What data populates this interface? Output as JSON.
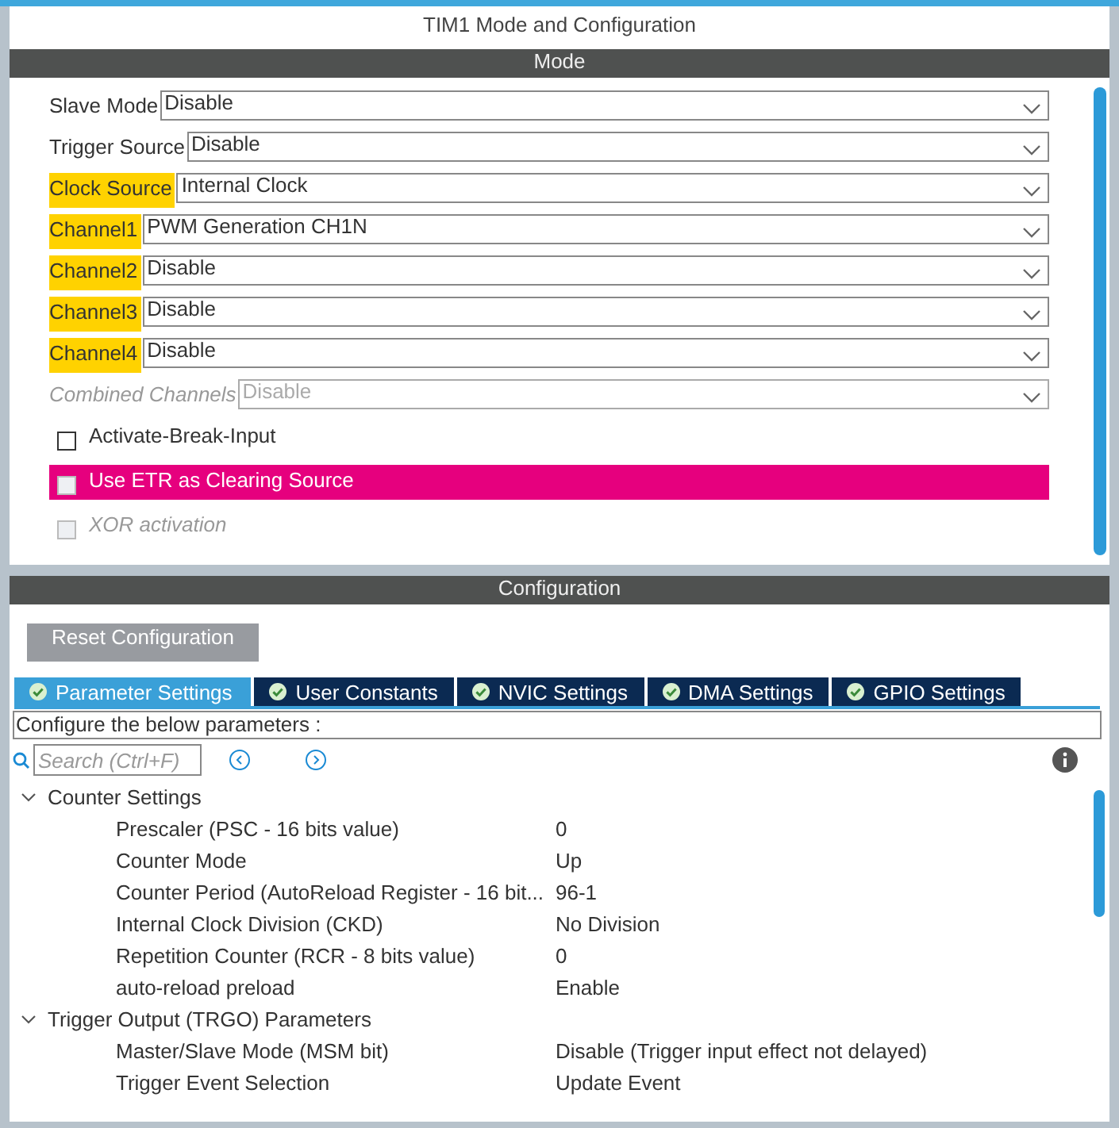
{
  "window": {
    "title": "TIM1 Mode and Configuration"
  },
  "mode": {
    "header": "Mode",
    "items": [
      {
        "kind": "select",
        "label": "Slave Mode",
        "value": "Disable",
        "highlighted": false,
        "disabled": false
      },
      {
        "kind": "select",
        "label": "Trigger Source",
        "value": "Disable",
        "highlighted": false,
        "disabled": false
      },
      {
        "kind": "select",
        "label": "Clock Source",
        "value": "Internal Clock",
        "highlighted": true,
        "disabled": false
      },
      {
        "kind": "select",
        "label": "Channel1",
        "value": "PWM Generation CH1N",
        "highlighted": true,
        "disabled": false
      },
      {
        "kind": "select",
        "label": "Channel2",
        "value": "Disable",
        "highlighted": true,
        "disabled": false
      },
      {
        "kind": "select",
        "label": "Channel3",
        "value": "Disable",
        "highlighted": true,
        "disabled": false
      },
      {
        "kind": "select",
        "label": "Channel4",
        "value": "Disable",
        "highlighted": true,
        "disabled": false
      },
      {
        "kind": "select",
        "label": "Combined Channels",
        "value": "Disable",
        "highlighted": false,
        "disabled": true
      },
      {
        "kind": "checkbox",
        "label": "Activate-Break-Input",
        "checked": false,
        "highlighted": false,
        "disabled": false
      },
      {
        "kind": "checkbox",
        "label": "Use ETR as Clearing Source",
        "checked": false,
        "highlighted": true,
        "disabled": true
      },
      {
        "kind": "checkbox",
        "label": "XOR activation",
        "checked": false,
        "highlighted": false,
        "disabled": true
      }
    ]
  },
  "configuration": {
    "header": "Configuration",
    "reset_button": "Reset Configuration",
    "tabs": [
      {
        "label": "Parameter Settings",
        "selected": true
      },
      {
        "label": "User Constants",
        "selected": false
      },
      {
        "label": "NVIC Settings",
        "selected": false
      },
      {
        "label": "DMA Settings",
        "selected": false
      },
      {
        "label": "GPIO Settings",
        "selected": false
      }
    ],
    "description": "Configure the below parameters :",
    "search": {
      "placeholder": "Search (Ctrl+F)"
    },
    "groups": [
      {
        "label": "Counter Settings",
        "expanded": true,
        "params": [
          {
            "name": "Prescaler (PSC - 16 bits value)",
            "value": "0"
          },
          {
            "name": "Counter Mode",
            "value": "Up"
          },
          {
            "name": "Counter Period (AutoReload Register - 16 bit...",
            "value": "96-1"
          },
          {
            "name": "Internal Clock Division (CKD)",
            "value": "No Division"
          },
          {
            "name": "Repetition Counter (RCR - 8 bits value)",
            "value": "0"
          },
          {
            "name": "auto-reload preload",
            "value": "Enable"
          }
        ]
      },
      {
        "label": "Trigger Output (TRGO) Parameters",
        "expanded": true,
        "params": [
          {
            "name": "Master/Slave Mode (MSM bit)",
            "value": "Disable (Trigger input effect not delayed)"
          },
          {
            "name": "Trigger Event Selection",
            "value": "Update Event"
          }
        ]
      }
    ]
  }
}
